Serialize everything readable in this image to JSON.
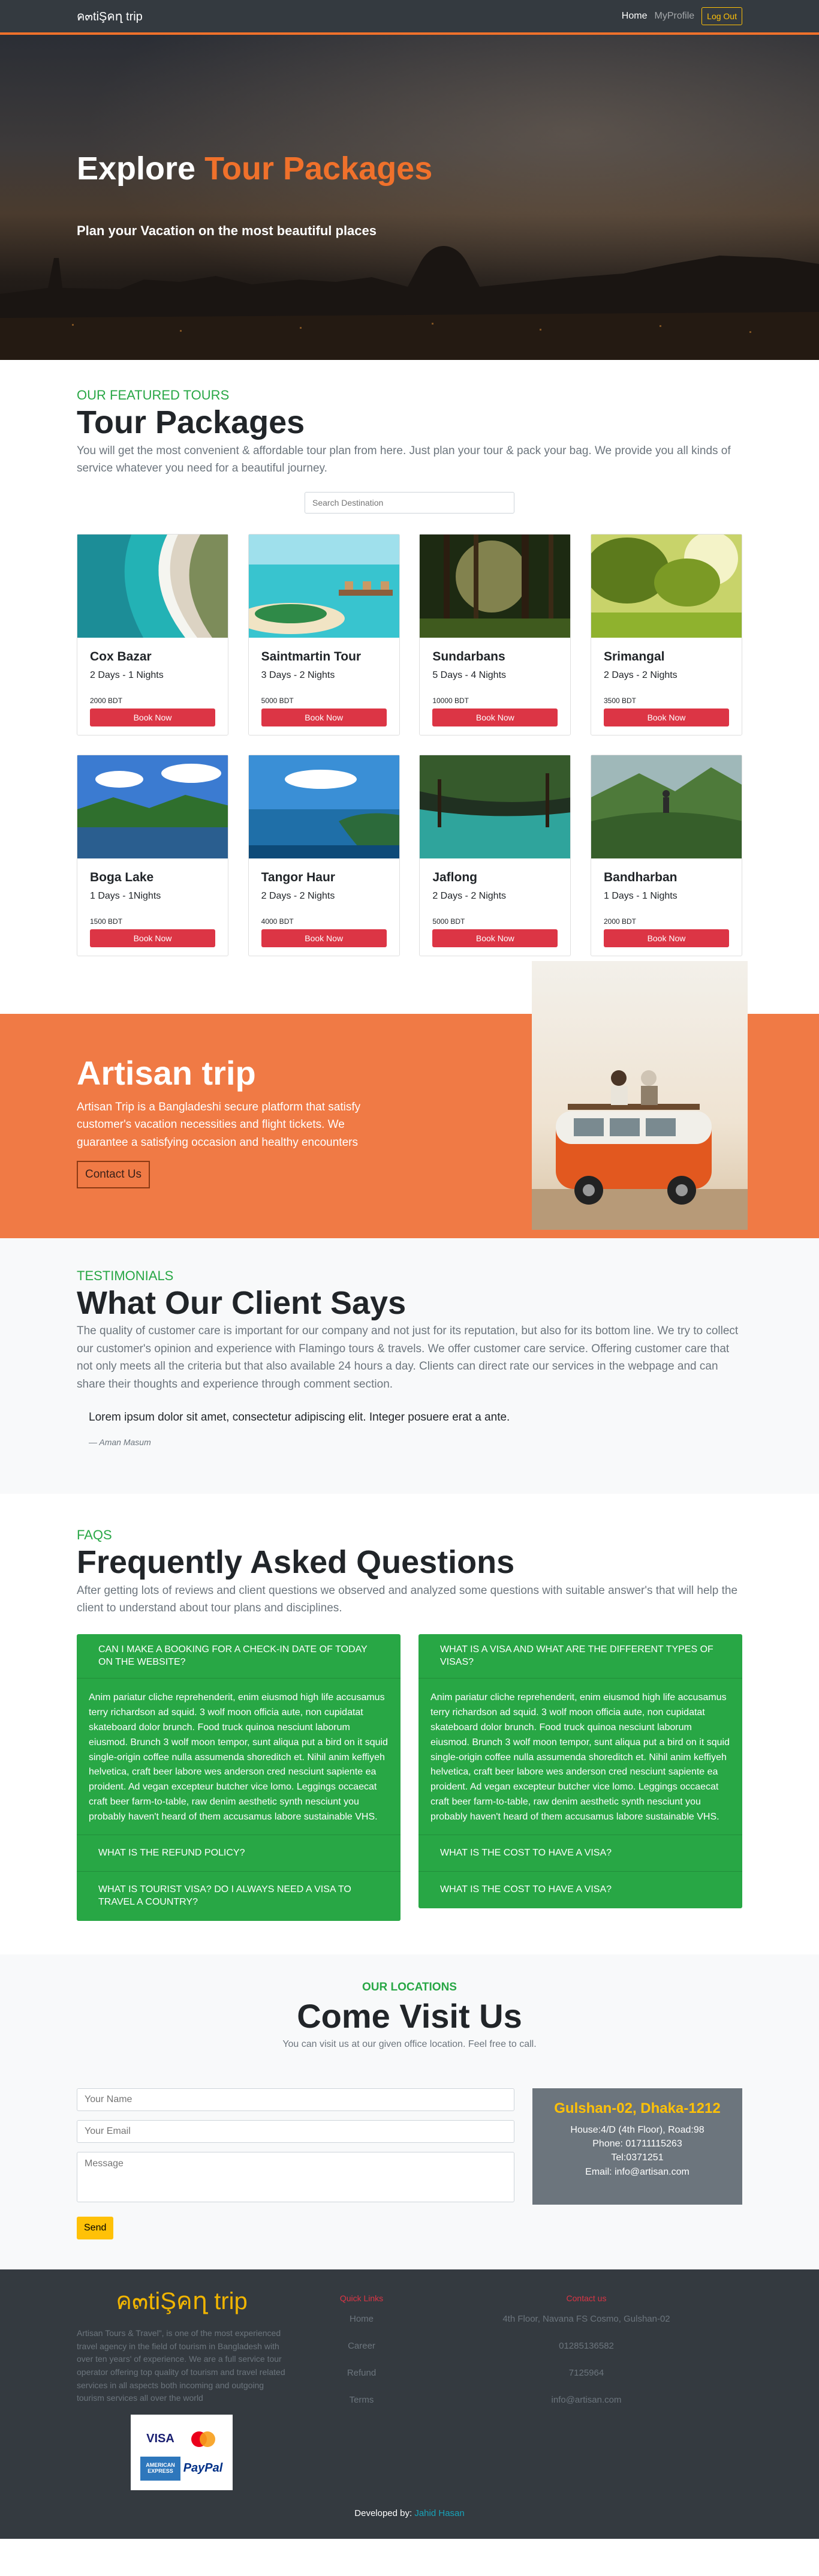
{
  "nav": {
    "brand": "ค๓tiŞคղ trip",
    "home": "Home",
    "profile": "MyProfile",
    "logout": "Log Out"
  },
  "hero": {
    "title_part1": "Explore ",
    "title_part2": "Tour Packages",
    "subtitle": "Plan your Vacation on the most beautiful places"
  },
  "tours": {
    "kicker": "OUR FEATURED TOURS",
    "title": "Tour Packages",
    "description": "You will get the most convenient & affordable tour plan from here. Just plan your tour & pack your bag. We provide you all kinds of service whatever you need for a beautiful journey.",
    "search_placeholder": "Search Destination",
    "book_label": "Book Now",
    "items": [
      {
        "name": "Cox Bazar",
        "duration": "2 Days - 1 Nights",
        "price": "2000 BDT",
        "image": "beach-aerial"
      },
      {
        "name": "Saintmartin Tour",
        "duration": "3 Days - 2 Nights",
        "price": "5000 BDT",
        "image": "island-resort"
      },
      {
        "name": "Sundarbans",
        "duration": "5 Days - 4 Nights",
        "price": "10000 BDT",
        "image": "forest"
      },
      {
        "name": "Srimangal",
        "duration": "2 Days - 2 Nights",
        "price": "3500 BDT",
        "image": "sunlit-trees"
      },
      {
        "name": "Boga Lake",
        "duration": "1 Days - 1Nights",
        "price": "1500 BDT",
        "image": "mountain-lake"
      },
      {
        "name": "Tangor Haur",
        "duration": "2 Days - 2 Nights",
        "price": "4000 BDT",
        "image": "coast-island"
      },
      {
        "name": "Jaflong",
        "duration": "2 Days - 2 Nights",
        "price": "5000 BDT",
        "image": "river-swamp"
      },
      {
        "name": "Bandharban",
        "duration": "1 Days - 1 Nights",
        "price": "2000 BDT",
        "image": "hiker-valley"
      }
    ]
  },
  "promo": {
    "title": "Artisan trip",
    "text": "Artisan Trip is a Bangladeshi secure platform that satisfy customer's vacation necessities and flight tickets. We guarantee a satisfying occasion and healthy encounters",
    "button": "Contact Us"
  },
  "testimonials": {
    "kicker": "TESTIMONIALS",
    "title": "What Our Client Says",
    "description": "The quality of customer care is important for our company and not just for its reputation, but also for its bottom line. We try to collect our customer's opinion and experience with Flamingo tours & travels. We offer customer care service. Offering customer care that not only meets all the criteria but that also available 24 hours a day. Clients can direct rate our services in the webpage and can share their thoughts and experience through comment section.",
    "quote": "Lorem ipsum dolor sit amet, consectetur adipiscing elit. Integer posuere erat a ante.",
    "author": "— Aman Masum"
  },
  "faq": {
    "kicker": "FAQS",
    "title": "Frequently Asked Questions",
    "description": "After getting lots of reviews and client questions we observed and analyzed some questions with suitable answer's that will help the client to understand about tour plans and disciplines.",
    "answer": "Anim pariatur cliche reprehenderit, enim eiusmod high life accusamus terry richardson ad squid. 3 wolf moon officia aute, non cupidatat skateboard dolor brunch. Food truck quinoa nesciunt laborum eiusmod. Brunch 3 wolf moon tempor, sunt aliqua put a bird on it squid single-origin coffee nulla assumenda shoreditch et. Nihil anim keffiyeh helvetica, craft beer labore wes anderson cred nesciunt sapiente ea proident. Ad vegan excepteur butcher vice lomo. Leggings occaecat craft beer farm-to-table, raw denim aesthetic synth nesciunt you probably haven't heard of them accusamus labore sustainable VHS.",
    "left": [
      "CAN I MAKE A BOOKING FOR A CHECK-IN DATE OF TODAY ON THE WEBSITE?",
      "WHAT IS THE REFUND POLICY?",
      "WHAT IS TOURIST VISA? DO I ALWAYS NEED A VISA TO TRAVEL A COUNTRY?"
    ],
    "right": [
      "WHAT IS A VISA AND WHAT ARE THE DIFFERENT TYPES OF VISAS?",
      "WHAT IS THE COST TO HAVE A VISA?",
      "WHAT IS THE COST TO HAVE A VISA?"
    ]
  },
  "locations": {
    "kicker": "OUR LOCATIONS",
    "title": "Come Visit Us",
    "subtitle": "You can visit us at our given office location. Feel free to call.",
    "form": {
      "name": "Your Name",
      "email": "Your Email",
      "message": "Message",
      "send": "Send"
    },
    "office": {
      "title": "Gulshan-02, Dhaka-1212",
      "address": "House:4/D (4th Floor), Road:98",
      "phone": "Phone: 01711115263",
      "tel": "Tel:0371251",
      "email": "Email: info@artisan.com"
    }
  },
  "footer": {
    "logo": "ค๓tiŞคղ trip",
    "about": "Artisan Tours & Travel\", is one of the most experienced travel agency in the field of tourism in Bangladesh with over ten years' of experience. We are a full service tour operator offering top quality of tourism and travel related services in all aspects both incoming and outgoing tourism services all over the world",
    "quick_title": "Quick Links",
    "quick": [
      "Home",
      "Career",
      "Refund",
      "Terms"
    ],
    "contact_title": "Contact us",
    "contact": [
      "4th Floor, Navana FS Cosmo, Gulshan-02",
      "01285136582",
      "7125964",
      "info@artisan.com"
    ],
    "cards": [
      "VISA",
      "mastercard",
      "AMERICAN EXPRESS",
      "PayPal"
    ],
    "dev_prefix": "Developed by: ",
    "dev_name": "Jahid Hasan"
  },
  "colors": {
    "accent": "#f0712b",
    "success": "#28a745",
    "danger": "#dc3545",
    "warning": "#ffc107",
    "dark": "#343a40"
  }
}
